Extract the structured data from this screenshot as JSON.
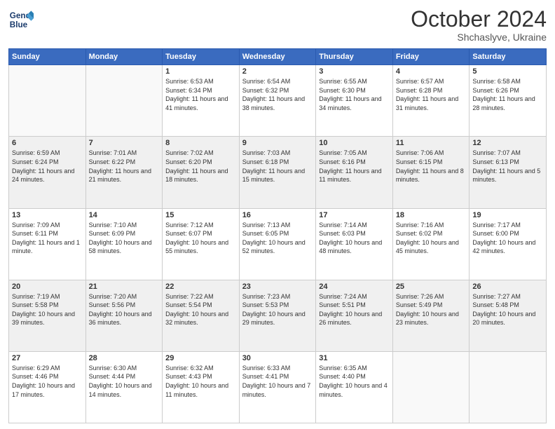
{
  "header": {
    "logo_line1": "General",
    "logo_line2": "Blue",
    "title": "October 2024",
    "location": "Shchaslyve, Ukraine"
  },
  "weekdays": [
    "Sunday",
    "Monday",
    "Tuesday",
    "Wednesday",
    "Thursday",
    "Friday",
    "Saturday"
  ],
  "weeks": [
    [
      {
        "day": "",
        "info": ""
      },
      {
        "day": "",
        "info": ""
      },
      {
        "day": "1",
        "info": "Sunrise: 6:53 AM\nSunset: 6:34 PM\nDaylight: 11 hours and 41 minutes."
      },
      {
        "day": "2",
        "info": "Sunrise: 6:54 AM\nSunset: 6:32 PM\nDaylight: 11 hours and 38 minutes."
      },
      {
        "day": "3",
        "info": "Sunrise: 6:55 AM\nSunset: 6:30 PM\nDaylight: 11 hours and 34 minutes."
      },
      {
        "day": "4",
        "info": "Sunrise: 6:57 AM\nSunset: 6:28 PM\nDaylight: 11 hours and 31 minutes."
      },
      {
        "day": "5",
        "info": "Sunrise: 6:58 AM\nSunset: 6:26 PM\nDaylight: 11 hours and 28 minutes."
      }
    ],
    [
      {
        "day": "6",
        "info": "Sunrise: 6:59 AM\nSunset: 6:24 PM\nDaylight: 11 hours and 24 minutes."
      },
      {
        "day": "7",
        "info": "Sunrise: 7:01 AM\nSunset: 6:22 PM\nDaylight: 11 hours and 21 minutes."
      },
      {
        "day": "8",
        "info": "Sunrise: 7:02 AM\nSunset: 6:20 PM\nDaylight: 11 hours and 18 minutes."
      },
      {
        "day": "9",
        "info": "Sunrise: 7:03 AM\nSunset: 6:18 PM\nDaylight: 11 hours and 15 minutes."
      },
      {
        "day": "10",
        "info": "Sunrise: 7:05 AM\nSunset: 6:16 PM\nDaylight: 11 hours and 11 minutes."
      },
      {
        "day": "11",
        "info": "Sunrise: 7:06 AM\nSunset: 6:15 PM\nDaylight: 11 hours and 8 minutes."
      },
      {
        "day": "12",
        "info": "Sunrise: 7:07 AM\nSunset: 6:13 PM\nDaylight: 11 hours and 5 minutes."
      }
    ],
    [
      {
        "day": "13",
        "info": "Sunrise: 7:09 AM\nSunset: 6:11 PM\nDaylight: 11 hours and 1 minute."
      },
      {
        "day": "14",
        "info": "Sunrise: 7:10 AM\nSunset: 6:09 PM\nDaylight: 10 hours and 58 minutes."
      },
      {
        "day": "15",
        "info": "Sunrise: 7:12 AM\nSunset: 6:07 PM\nDaylight: 10 hours and 55 minutes."
      },
      {
        "day": "16",
        "info": "Sunrise: 7:13 AM\nSunset: 6:05 PM\nDaylight: 10 hours and 52 minutes."
      },
      {
        "day": "17",
        "info": "Sunrise: 7:14 AM\nSunset: 6:03 PM\nDaylight: 10 hours and 48 minutes."
      },
      {
        "day": "18",
        "info": "Sunrise: 7:16 AM\nSunset: 6:02 PM\nDaylight: 10 hours and 45 minutes."
      },
      {
        "day": "19",
        "info": "Sunrise: 7:17 AM\nSunset: 6:00 PM\nDaylight: 10 hours and 42 minutes."
      }
    ],
    [
      {
        "day": "20",
        "info": "Sunrise: 7:19 AM\nSunset: 5:58 PM\nDaylight: 10 hours and 39 minutes."
      },
      {
        "day": "21",
        "info": "Sunrise: 7:20 AM\nSunset: 5:56 PM\nDaylight: 10 hours and 36 minutes."
      },
      {
        "day": "22",
        "info": "Sunrise: 7:22 AM\nSunset: 5:54 PM\nDaylight: 10 hours and 32 minutes."
      },
      {
        "day": "23",
        "info": "Sunrise: 7:23 AM\nSunset: 5:53 PM\nDaylight: 10 hours and 29 minutes."
      },
      {
        "day": "24",
        "info": "Sunrise: 7:24 AM\nSunset: 5:51 PM\nDaylight: 10 hours and 26 minutes."
      },
      {
        "day": "25",
        "info": "Sunrise: 7:26 AM\nSunset: 5:49 PM\nDaylight: 10 hours and 23 minutes."
      },
      {
        "day": "26",
        "info": "Sunrise: 7:27 AM\nSunset: 5:48 PM\nDaylight: 10 hours and 20 minutes."
      }
    ],
    [
      {
        "day": "27",
        "info": "Sunrise: 6:29 AM\nSunset: 4:46 PM\nDaylight: 10 hours and 17 minutes."
      },
      {
        "day": "28",
        "info": "Sunrise: 6:30 AM\nSunset: 4:44 PM\nDaylight: 10 hours and 14 minutes."
      },
      {
        "day": "29",
        "info": "Sunrise: 6:32 AM\nSunset: 4:43 PM\nDaylight: 10 hours and 11 minutes."
      },
      {
        "day": "30",
        "info": "Sunrise: 6:33 AM\nSunset: 4:41 PM\nDaylight: 10 hours and 7 minutes."
      },
      {
        "day": "31",
        "info": "Sunrise: 6:35 AM\nSunset: 4:40 PM\nDaylight: 10 hours and 4 minutes."
      },
      {
        "day": "",
        "info": ""
      },
      {
        "day": "",
        "info": ""
      }
    ]
  ]
}
